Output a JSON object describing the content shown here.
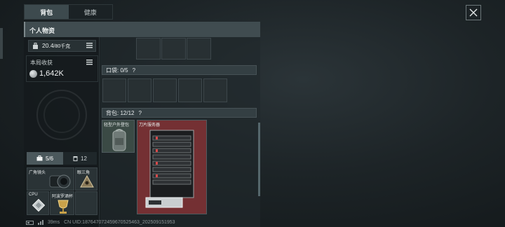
{
  "tabs": [
    {
      "label": "背包",
      "active": true
    },
    {
      "label": "健康",
      "active": false
    }
  ],
  "header": {
    "title": "个人物资"
  },
  "weight": {
    "current": "20.4",
    "max": "/80千克"
  },
  "income": {
    "label": "本局收获",
    "value": "1,642K"
  },
  "subtabs": [
    {
      "label": "5/6",
      "icon": "briefcase-icon"
    },
    {
      "label": "12",
      "icon": "trash-icon"
    }
  ],
  "equipment_slots": [
    {
      "label": "广角镜头",
      "icon": "camera-lens-icon"
    },
    {
      "label": "眼三角",
      "icon": "triangle-badge-icon"
    },
    {
      "label": "CPU",
      "icon": "cpu-chip-icon"
    },
    {
      "label": "阿波罗酒杯",
      "icon": "gold-cup-icon"
    }
  ],
  "pocket": {
    "label": "口袋: 0/5",
    "help": "?"
  },
  "backpack": {
    "label": "背包: 12/12",
    "help": "?"
  },
  "items": [
    {
      "label": "轻型户外登包",
      "icon": "backpack-icon"
    },
    {
      "label": "刀片服务器",
      "icon": "blade-server-icon"
    }
  ],
  "footer": {
    "ping": "39ms",
    "uid": "CN UID:18764707245967052546​3_202509151953"
  },
  "colors": {
    "item_highlight": "#7d3335",
    "panel": "#21292c"
  }
}
